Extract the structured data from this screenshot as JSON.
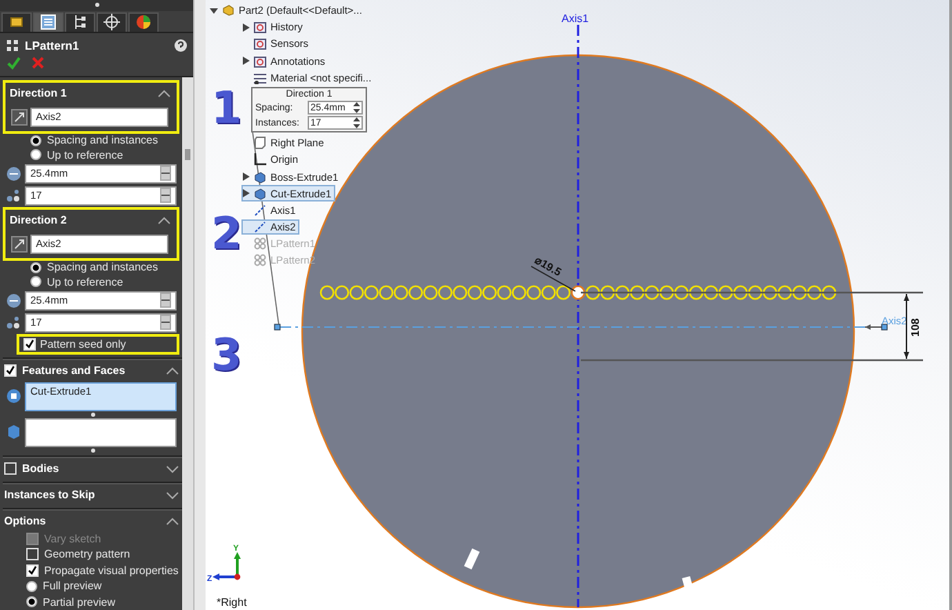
{
  "panel": {
    "tabs": [
      {
        "selected": false
      },
      {
        "selected": true
      },
      {
        "selected": false
      },
      {
        "selected": false
      },
      {
        "selected": false
      }
    ],
    "title": "LPattern1",
    "direction_1": {
      "title": "Direction 1",
      "axis": "Axis2",
      "options": [
        {
          "label": "Spacing and instances",
          "selected": true
        },
        {
          "label": "Up to reference",
          "selected": false
        }
      ],
      "spacing": "25.4mm",
      "instances": "17"
    },
    "direction_2": {
      "title": "Direction 2",
      "axis": "Axis2",
      "options": [
        {
          "label": "Spacing and instances",
          "selected": true
        },
        {
          "label": "Up to reference",
          "selected": false
        }
      ],
      "spacing": "25.4mm",
      "instances": "17",
      "pattern_seed_only": {
        "label": "Pattern seed only",
        "checked": true
      }
    },
    "features_and_faces": {
      "title": "Features and Faces",
      "checked": true,
      "features": [
        "Cut-Extrude1"
      ]
    },
    "bodies": {
      "title": "Bodies",
      "checked": false
    },
    "instances_to_skip": {
      "title": "Instances to Skip"
    },
    "options": {
      "title": "Options",
      "checkboxes": [
        {
          "label": "Vary sketch",
          "checked": false,
          "disabled": true
        },
        {
          "label": "Geometry pattern",
          "checked": false,
          "disabled": false
        },
        {
          "label": "Propagate visual properties",
          "checked": true,
          "disabled": false
        }
      ],
      "preview": [
        {
          "label": "Full preview",
          "selected": false
        },
        {
          "label": "Partial preview",
          "selected": true
        }
      ]
    }
  },
  "tree": {
    "root": "Part2 (Default<<Default>...",
    "items": [
      {
        "label": "History",
        "kind": "folder",
        "expander": true,
        "selected": false,
        "disabled": false
      },
      {
        "label": "Sensors",
        "kind": "folder",
        "expander": false,
        "selected": false,
        "disabled": false
      },
      {
        "label": "Annotations",
        "kind": "folder",
        "expander": true,
        "selected": false,
        "disabled": false
      },
      {
        "label": "Material <not specifi...",
        "kind": "material",
        "expander": false,
        "selected": false,
        "disabled": false
      },
      {
        "label": "Right Plane",
        "kind": "plane",
        "expander": false,
        "selected": false,
        "disabled": false
      },
      {
        "label": "Origin",
        "kind": "origin",
        "expander": false,
        "selected": false,
        "disabled": false
      },
      {
        "label": "Boss-Extrude1",
        "kind": "feature",
        "expander": true,
        "selected": false,
        "disabled": false
      },
      {
        "label": "Cut-Extrude1",
        "kind": "feature",
        "expander": true,
        "selected": true,
        "disabled": false
      },
      {
        "label": "Axis1",
        "kind": "axis",
        "expander": false,
        "selected": false,
        "disabled": false
      },
      {
        "label": "Axis2",
        "kind": "axis",
        "expander": false,
        "selected": true,
        "disabled": false
      },
      {
        "label": "LPattern1",
        "kind": "pattern",
        "expander": false,
        "selected": false,
        "disabled": true
      },
      {
        "label": "LPattern2",
        "kind": "pattern",
        "expander": false,
        "selected": false,
        "disabled": true
      }
    ]
  },
  "callout": {
    "title": "Direction 1",
    "rows": [
      {
        "label": "Spacing:",
        "value": "25.4mm"
      },
      {
        "label": "Instances:",
        "value": "17"
      }
    ]
  },
  "step_markers": [
    "1",
    "2",
    "3"
  ],
  "viewport": {
    "axis_1_label": "Axis1",
    "axis_2_label": "Axis2",
    "hole_diameter": "⌀19.5",
    "offset_dimension": "108",
    "view_name": "*Right",
    "triad": {
      "y": "Y",
      "z": "Z"
    }
  }
}
